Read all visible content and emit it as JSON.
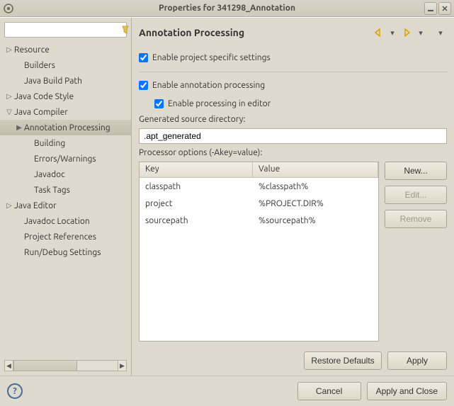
{
  "window": {
    "title": "Properties for 341298_Annotation"
  },
  "filter": {
    "placeholder": ""
  },
  "tree": [
    {
      "label": "Resource",
      "depth": 1,
      "twisty": "▷",
      "selected": false
    },
    {
      "label": "Builders",
      "depth": 2,
      "twisty": "",
      "selected": false
    },
    {
      "label": "Java Build Path",
      "depth": 2,
      "twisty": "",
      "selected": false
    },
    {
      "label": "Java Code Style",
      "depth": 1,
      "twisty": "▷",
      "selected": false
    },
    {
      "label": "Java Compiler",
      "depth": 1,
      "twisty": "▽",
      "selected": false
    },
    {
      "label": "Annotation Processing",
      "depth": 2,
      "twisty": "▶",
      "selected": true
    },
    {
      "label": "Building",
      "depth": 3,
      "twisty": "",
      "selected": false
    },
    {
      "label": "Errors/Warnings",
      "depth": 3,
      "twisty": "",
      "selected": false
    },
    {
      "label": "Javadoc",
      "depth": 3,
      "twisty": "",
      "selected": false
    },
    {
      "label": "Task Tags",
      "depth": 3,
      "twisty": "",
      "selected": false
    },
    {
      "label": "Java Editor",
      "depth": 1,
      "twisty": "▷",
      "selected": false
    },
    {
      "label": "Javadoc Location",
      "depth": 2,
      "twisty": "",
      "selected": false
    },
    {
      "label": "Project References",
      "depth": 2,
      "twisty": "",
      "selected": false
    },
    {
      "label": "Run/Debug Settings",
      "depth": 2,
      "twisty": "",
      "selected": false
    }
  ],
  "page": {
    "title": "Annotation Processing",
    "checks": {
      "project_specific": {
        "label": "Enable project specific settings",
        "checked": true
      },
      "enable_ap": {
        "label": "Enable annotation processing",
        "checked": true
      },
      "enable_editor": {
        "label": "Enable processing in editor",
        "checked": true
      }
    },
    "gen_src_label": "Generated source directory:",
    "gen_src_value": ".apt_generated",
    "options_label": "Processor options (-Akey=value):",
    "table": {
      "cols": {
        "key": "Key",
        "value": "Value"
      },
      "rows": [
        {
          "key": "classpath",
          "value": "%classpath%"
        },
        {
          "key": "project",
          "value": "%PROJECT.DIR%"
        },
        {
          "key": "sourcepath",
          "value": "%sourcepath%"
        }
      ]
    },
    "buttons": {
      "new": "New...",
      "edit": "Edit...",
      "remove": "Remove",
      "restore": "Restore Defaults",
      "apply": "Apply"
    }
  },
  "footer": {
    "cancel": "Cancel",
    "apply_close": "Apply and Close"
  }
}
